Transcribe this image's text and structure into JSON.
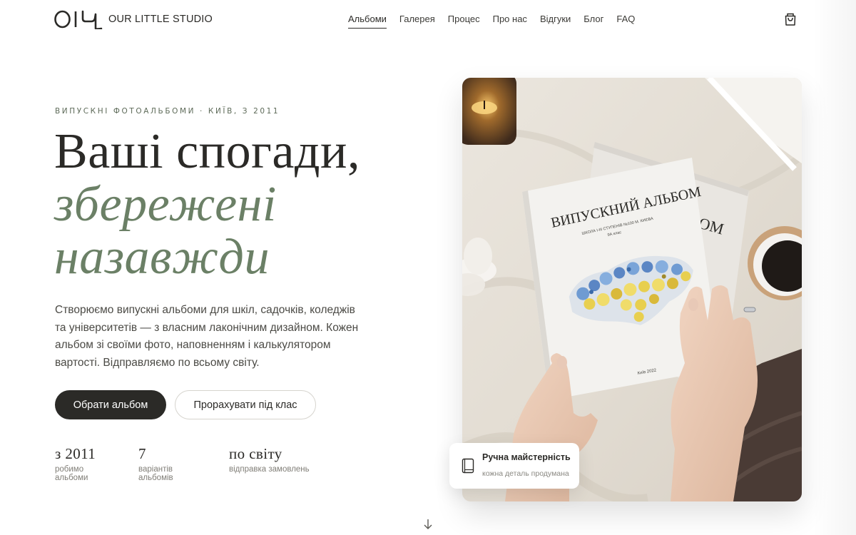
{
  "brand": {
    "logo_mark": "OIЧ",
    "name": "OUR LITTLE STUDIO"
  },
  "nav": {
    "items": [
      {
        "label": "Альбоми",
        "active": true
      },
      {
        "label": "Галерея",
        "active": false
      },
      {
        "label": "Процес",
        "active": false
      },
      {
        "label": "Про нас",
        "active": false
      },
      {
        "label": "Відгуки",
        "active": false
      },
      {
        "label": "Блог",
        "active": false
      },
      {
        "label": "FAQ",
        "active": false
      }
    ],
    "cart_icon": "shopping-bag-icon"
  },
  "hero": {
    "eyebrow": "ВИПУСКНІ ФОТОАЛЬБОМИ · КИЇВ, З 2011",
    "title_line1": "Ваші спогади,",
    "title_line2": "збережені",
    "title_line3": "назавжди",
    "lead": "Створюємо випускні альбоми для шкіл, садочків, коледжів та університетів — з власним лаконічним дизайном. Кожен альбом зі своїми фото, наповненням і калькулятором вартості. Відправляємо по всьому світу.",
    "primary_button": "Обрати альбом",
    "secondary_button": "Прорахувати під клас",
    "stats": [
      {
        "value": "з 2011",
        "label": "робимо альбоми"
      },
      {
        "value": "7",
        "label": "варіантів альбомів"
      },
      {
        "value": "по світу",
        "label": "відправка замовлень"
      }
    ],
    "scroll_icon": "arrow-down-icon"
  },
  "photo": {
    "book_title": "ВИПУСКНИЙ АЛЬБОМ",
    "book_subtitle": "ШКОЛА І-ІІІ СТУПЕНІВ №100 М. КИЄВА",
    "book_class": "9А клас",
    "book_footer": "Київ 2022",
    "back_book_fragment": "ОМ"
  },
  "badge": {
    "icon": "book-icon",
    "title": "Ручна майстерність",
    "subtitle": "кожна деталь продумана"
  },
  "colors": {
    "text": "#2b2a27",
    "accent_green": "#6b8066",
    "eyebrow": "#5d6a58",
    "primary_button_bg": "#2b2a27"
  }
}
